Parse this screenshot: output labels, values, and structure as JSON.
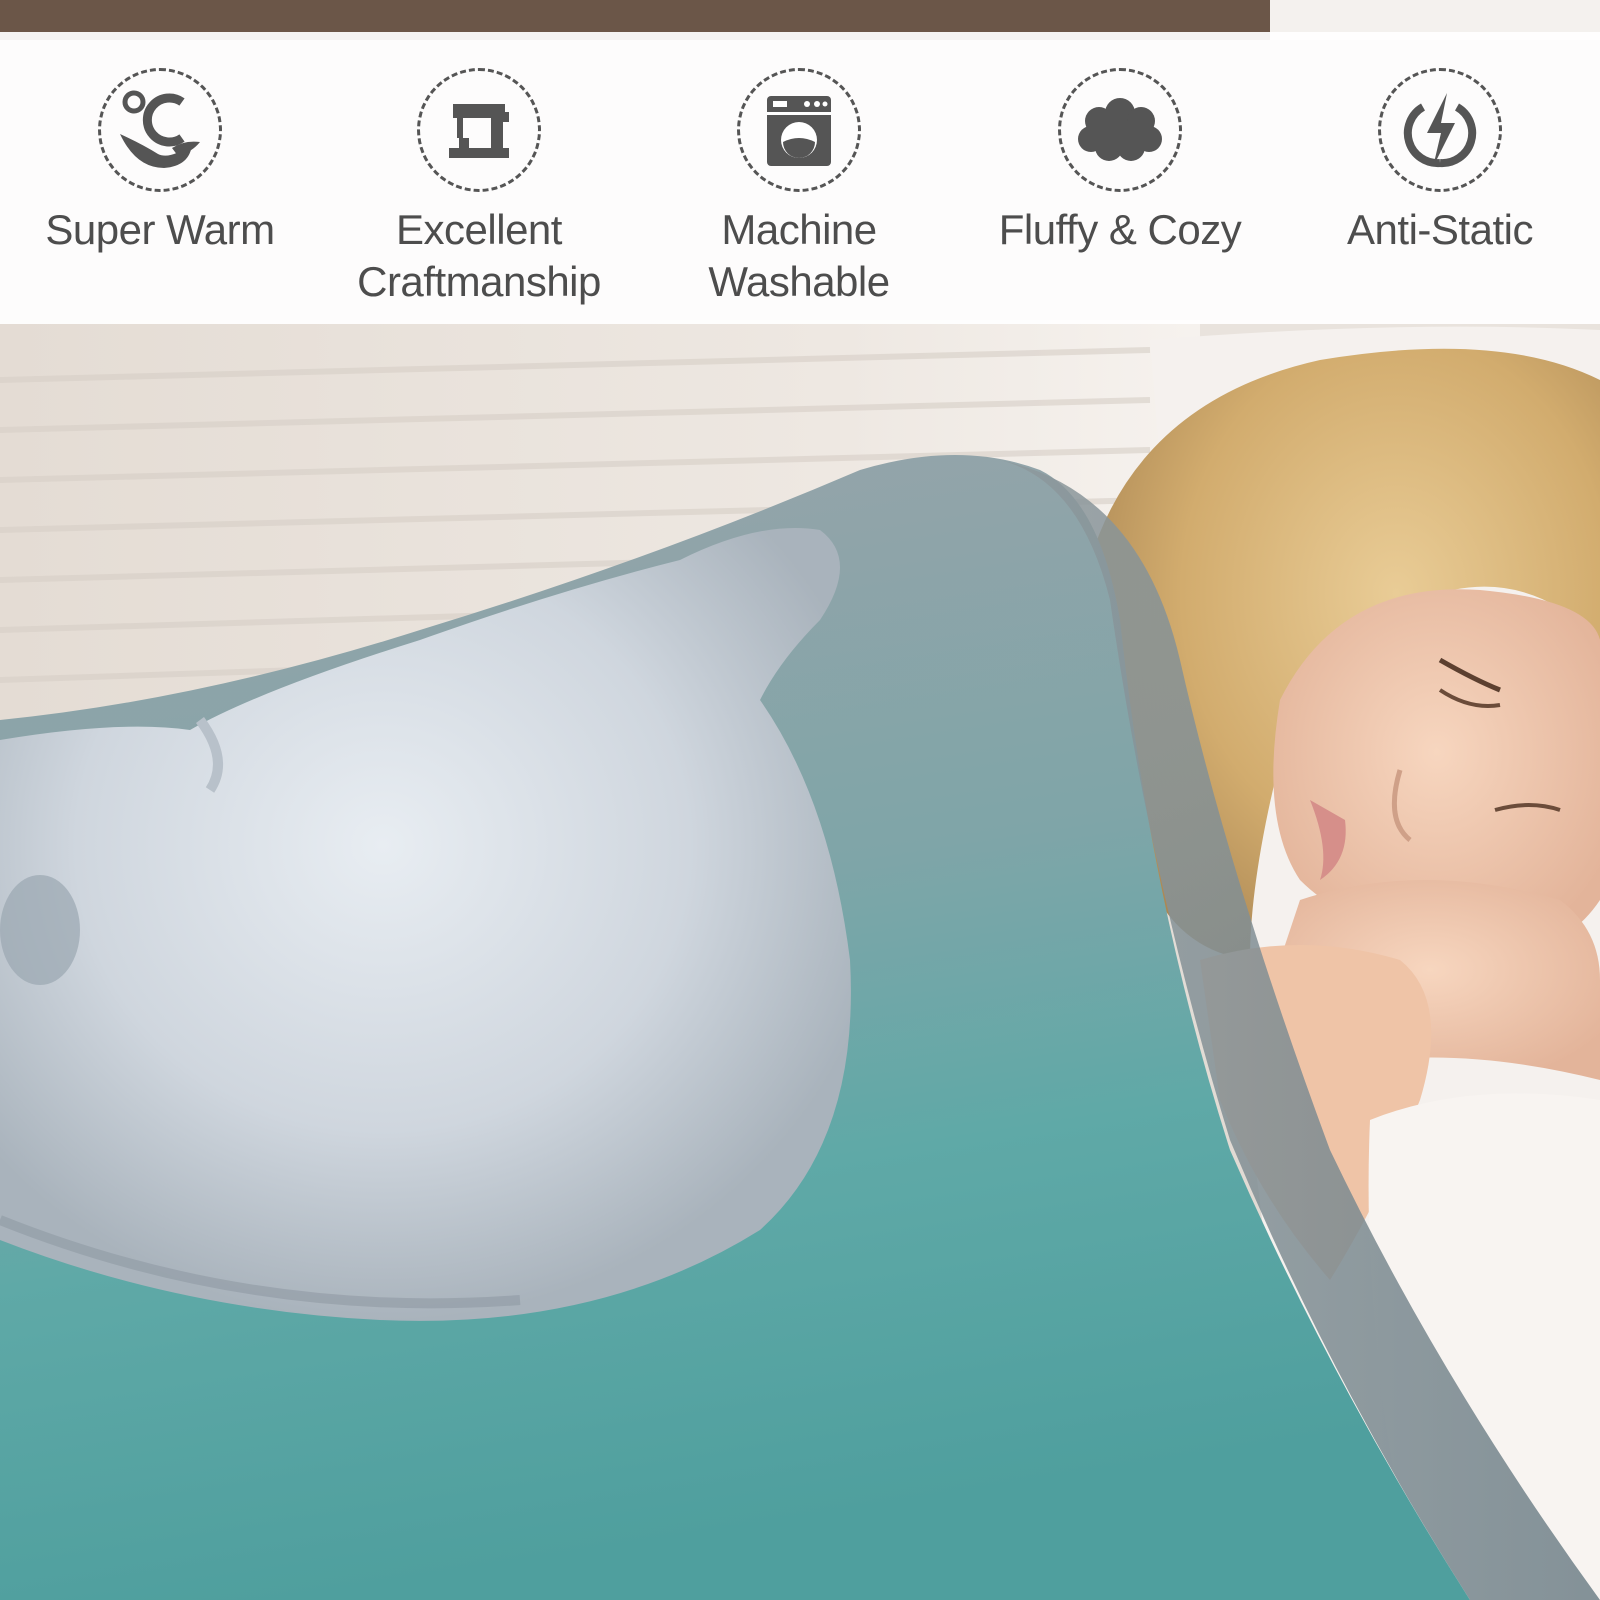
{
  "features": [
    {
      "label": "Super Warm",
      "icon": "warm-icon"
    },
    {
      "label": "Excellent\nCraftmanship",
      "icon": "sewing-machine-icon"
    },
    {
      "label": "Machine\nWashable",
      "icon": "washing-machine-icon"
    },
    {
      "label": "Fluffy & Cozy",
      "icon": "cloud-icon"
    },
    {
      "label": "Anti-Static",
      "icon": "lightning-icon"
    }
  ],
  "colors": {
    "banner_bg": "#ffffff",
    "icon_gray": "#555555",
    "label_gray": "#4d4d4d",
    "blanket_teal": "#5aa8a6",
    "blanket_gray": "#8f9ba0",
    "hair_blonde": "#d8b47a",
    "skin": "#f1c9ad"
  }
}
